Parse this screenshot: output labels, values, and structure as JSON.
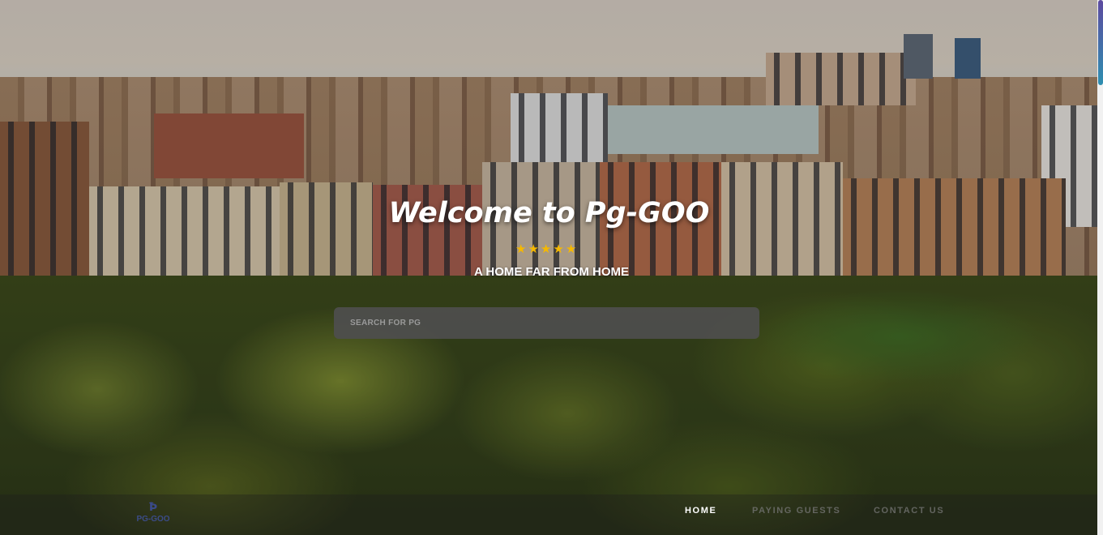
{
  "hero": {
    "title": "Welcome to Pg-GOO",
    "rating_stars": 5,
    "star_glyph": "★",
    "tagline": "A HOME FAR FROM HOME"
  },
  "search": {
    "placeholder": "SEARCH FOR PG",
    "value": ""
  },
  "brand": {
    "logo_mark": "Ꝥ",
    "logo_text": "PG-GOO"
  },
  "nav": {
    "items": [
      {
        "label": "HOME",
        "active": true
      },
      {
        "label": "PAYING GUESTS",
        "active": false
      },
      {
        "label": "CONTACT US",
        "active": false
      }
    ]
  },
  "colors": {
    "star": "#f5b800",
    "accent": "#3b4c88",
    "search_bg": "#4e4e4e",
    "scrollbar_thumb": "#5d4aa0"
  },
  "icons": {
    "rating": "star-icon",
    "logo": "pg-goo-logo-icon"
  }
}
